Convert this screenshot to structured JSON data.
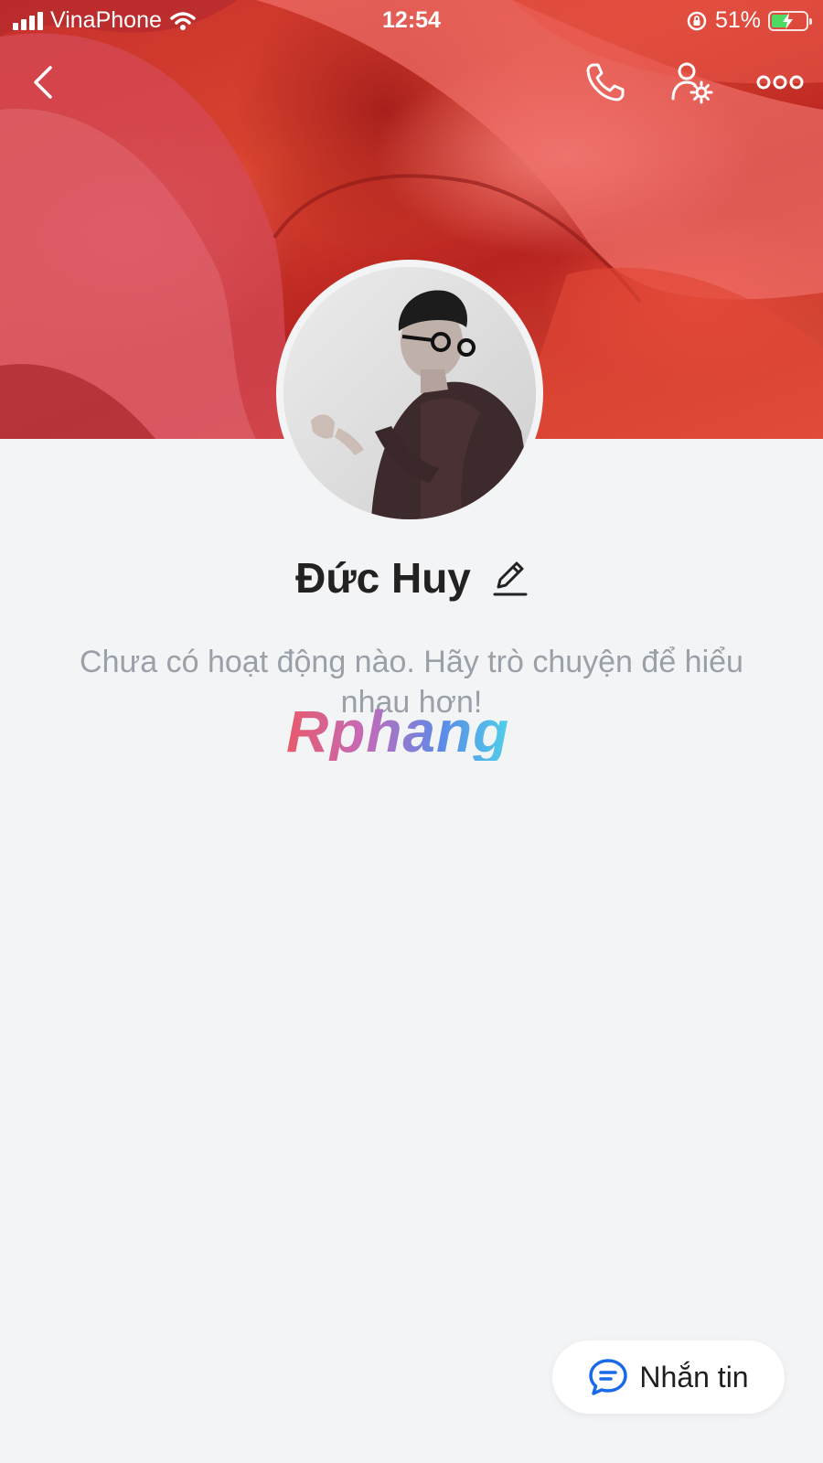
{
  "status_bar": {
    "carrier": "VinaPhone",
    "time": "12:54",
    "battery": "51%",
    "battery_level": 0.51
  },
  "header": {
    "back_icon": "chevron-left-icon",
    "call_icon": "phone-icon",
    "settings_icon": "user-settings-icon",
    "more_icon": "more-dots-icon"
  },
  "profile": {
    "name": "Đức Huy",
    "edit_icon": "pencil-icon",
    "empty_message": "Chưa có hoạt động nào. Hãy trò chuyện để hiểu nhau hơn!"
  },
  "watermark": "Rphang",
  "message_button": {
    "label": "Nhắn tin",
    "icon": "chat-bubble-icon",
    "accent": "#1a6ae8"
  }
}
